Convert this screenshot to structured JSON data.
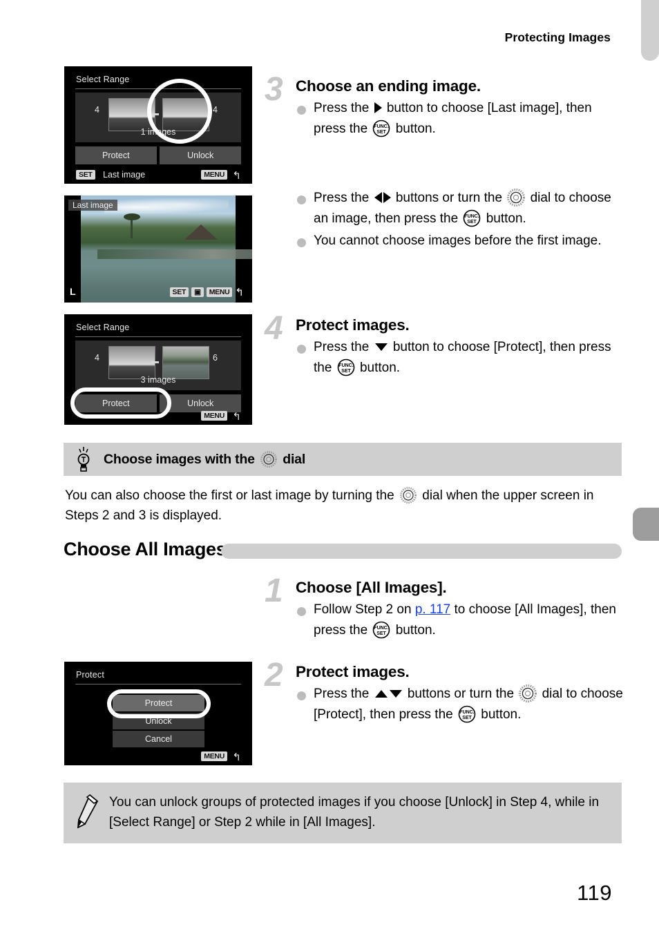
{
  "header": {
    "title": "Protecting Images"
  },
  "page_number": "119",
  "screens": {
    "select_range_1": {
      "title": "Select Range",
      "left_number": "4",
      "right_number": "4",
      "count_label": "1 images",
      "option_left": "Protect",
      "option_right": "Unlock",
      "set_badge": "SET",
      "set_label": "Last image",
      "menu_badge": "MENU",
      "menu_arrow": "↰"
    },
    "last_image": {
      "badge": "Last image",
      "quality": "L",
      "set_badge": "SET",
      "menu_badge": "MENU",
      "menu_arrow": "↰"
    },
    "select_range_2": {
      "title": "Select Range",
      "left_number": "4",
      "right_number": "6",
      "count_label": "3 images",
      "option_left": "Protect",
      "option_right": "Unlock",
      "menu_badge": "MENU",
      "menu_arrow": "↰"
    },
    "protect_menu": {
      "title": "Protect",
      "items": [
        "Protect",
        "Unlock",
        "Cancel"
      ],
      "selected": "Protect",
      "menu_badge": "MENU",
      "menu_arrow": "↰"
    }
  },
  "steps": {
    "step3": {
      "number": "3",
      "title": "Choose an ending image.",
      "b1_a": "Press the",
      "b1_b": "button to choose [Last image], then press the",
      "b1_c": "button.",
      "b2_a": "Press the",
      "b2_b": "buttons or turn the",
      "b2_c": "dial to choose an image, then press the",
      "b2_d": "button.",
      "b3": "You cannot choose images before the first image."
    },
    "step4": {
      "number": "4",
      "title": "Protect images.",
      "b1_a": "Press the",
      "b1_b": "button to choose [Protect], then press the",
      "b1_c": "button."
    },
    "all_step1": {
      "number": "1",
      "title": "Choose [All Images].",
      "b1_a": "Follow Step 2 on",
      "b1_link": "p. 117",
      "b1_b": "to choose [All Images], then press the",
      "b1_c": "button."
    },
    "all_step2": {
      "number": "2",
      "title": "Protect images.",
      "b1_a": "Press the",
      "b1_b": "buttons or turn the",
      "b1_c": "dial to choose [Protect], then press the",
      "b1_d": "button."
    }
  },
  "tip": {
    "title_a": "Choose images with the",
    "title_b": "dial",
    "body_a": "You can also choose the first or last image by turning the",
    "body_b": "dial when the upper screen in Steps 2 and 3 is displayed."
  },
  "section": {
    "title": "Choose All Images"
  },
  "note": {
    "text": "You can unlock groups of protected images if you choose [Unlock] in Step 4, while in [Select Range] or Step 2 while in [All Images]."
  },
  "colors": {
    "tab_top": "#cfcfcf",
    "tab_mid": "#9d9d9d",
    "box_gray": "#cfcfcf",
    "step_num": "#c6c6c6",
    "link": "#1a3fdd",
    "bullet": "#bcbcbc"
  }
}
